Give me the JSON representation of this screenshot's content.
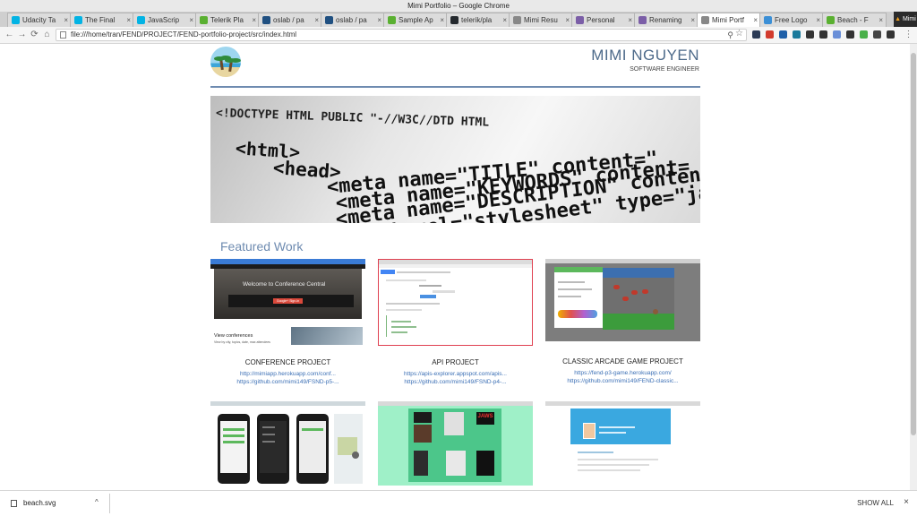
{
  "window": {
    "title": "Mimi Portfolio – Google Chrome"
  },
  "tabs": [
    {
      "label": "Udacity Ta",
      "color": "#02b3e4"
    },
    {
      "label": "The Final",
      "color": "#02b3e4"
    },
    {
      "label": "JavaScrip",
      "color": "#02b3e4"
    },
    {
      "label": "Telerik Pla",
      "color": "#5ab031"
    },
    {
      "label": "oslab / pa",
      "color": "#205081"
    },
    {
      "label": "oslab / pa",
      "color": "#205081"
    },
    {
      "label": "Sample Ap",
      "color": "#5ab031"
    },
    {
      "label": "telerik/pla",
      "color": "#24292e"
    },
    {
      "label": "Mimi Resu",
      "color": "#888888"
    },
    {
      "label": "Personal",
      "color": "#7b5ea7"
    },
    {
      "label": "Renaming",
      "color": "#7b5ea7"
    },
    {
      "label": "Mimi Portf",
      "color": "#888888",
      "active": true
    },
    {
      "label": "Free Logo",
      "color": "#3b8fd6"
    },
    {
      "label": "Beach - F",
      "color": "#5ab031"
    }
  ],
  "profile": {
    "label": "Mimi"
  },
  "toolbar": {
    "back": "←",
    "forward": "→",
    "reload": "⟳",
    "home": "⌂",
    "url": "file:///home/tran/FEND/PROJECT/FEND-portfolio-project/src/index.html",
    "zoom_icon": "⚲",
    "star_icon": "☆",
    "extension_colors": [
      "#2b3a55",
      "#d23b2e",
      "#1e5fa8",
      "#1a7a9c",
      "#333333",
      "#333333",
      "#6a8fd8",
      "#333333",
      "#48b048",
      "#444444",
      "#333333"
    ]
  },
  "page": {
    "name": "MIMI NGUYEN",
    "role": "SOFTWARE ENGINEER",
    "hero_lines": [
      "<!DOCTYPE HTML PUBLIC \"-//W3C//DTD HTML",
      "<html>",
      "<head>",
      "<meta name=\"TITLE\" content=\"",
      "<meta name=\"KEYWORDS\" content=",
      "<meta name=\"DESCRIPTION\" content",
      "<link rel=\"stylesheet\" type=\"javasc"
    ],
    "featured_heading": "Featured Work",
    "projects": [
      {
        "title": "CONFERENCE PROJECT",
        "links": [
          "http://mimiapp.herokuapp.com/conf...",
          "https://github.com/mimi149/FSND-p5-..."
        ],
        "overlay_title": "Welcome to Conference Central",
        "overlay_button": "Google+ Sign-in",
        "caption": "View conferences",
        "caption_sub": "View by city, topics, date, max attendees"
      },
      {
        "title": "API PROJECT",
        "links": [
          "https://apis-explorer.appspot.com/apis...",
          "https://github.com/mimi149/FSND-p4-..."
        ]
      },
      {
        "title": "CLASSIC ARCADE GAME PROJECT",
        "links": [
          "https://fend-p3-game.herokuapp.com/",
          "https://github.com/mimi149/FEND-classic..."
        ]
      },
      {
        "title": "",
        "links": []
      },
      {
        "title": "",
        "links": [],
        "banner": "JAWS"
      },
      {
        "title": "",
        "links": []
      }
    ]
  },
  "downloads": {
    "file": "beach.svg",
    "chevron": "^",
    "show_all": "SHOW ALL",
    "close": "×"
  }
}
